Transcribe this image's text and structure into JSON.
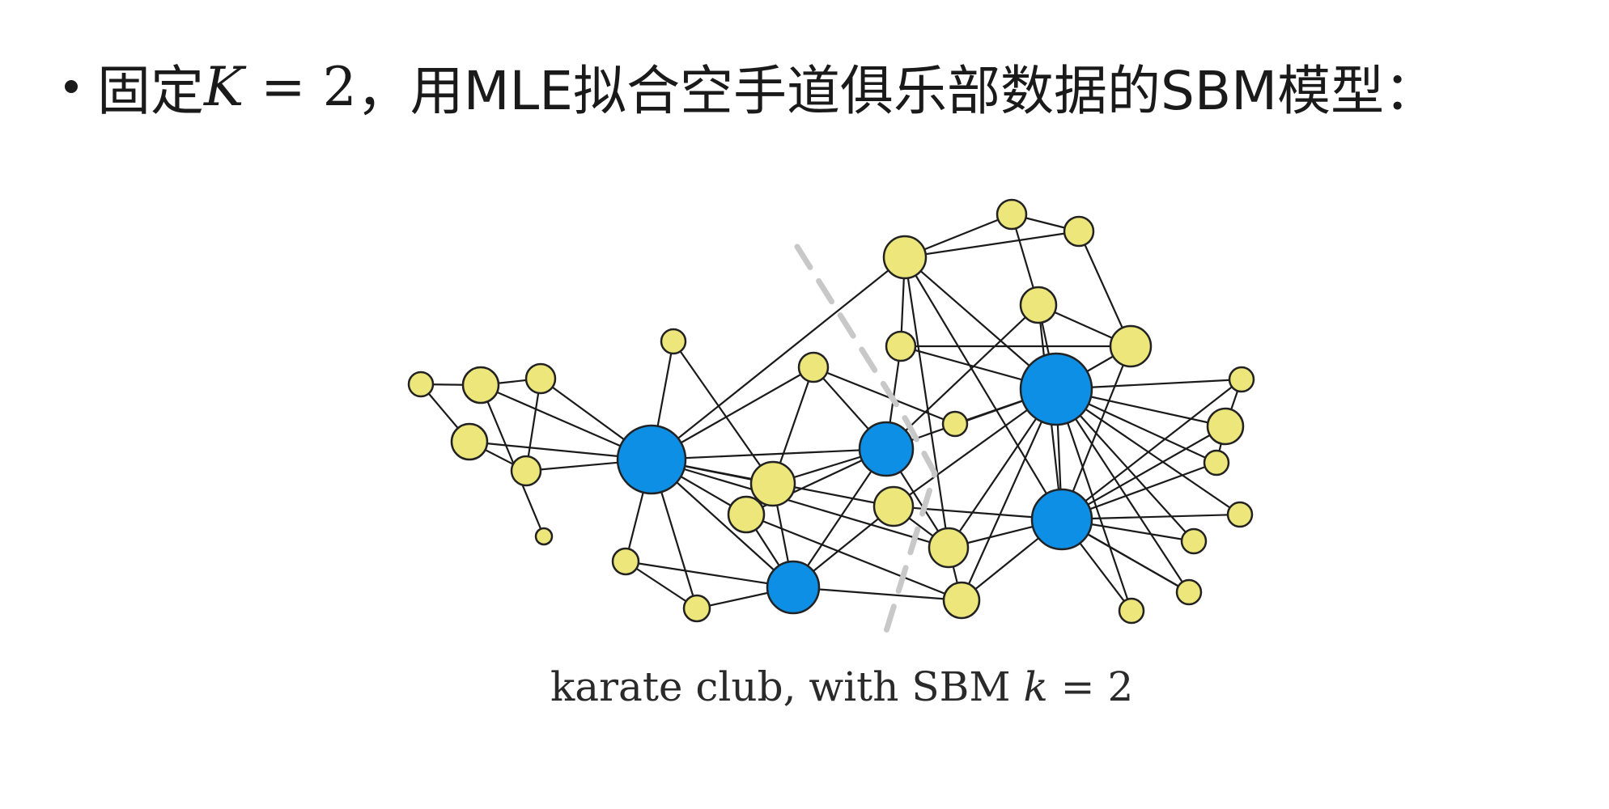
{
  "heading": {
    "prefix": "固定",
    "variable": "K",
    "equation": " = 2",
    "suffix": "，用MLE拟合空手道俱乐部数据的SBM模型："
  },
  "caption": {
    "text": "karate club, with SBM ",
    "variable": "k",
    "equation": " = 2"
  },
  "colors": {
    "hub": "#0d8fe6",
    "node": "#ede67a",
    "edge": "#1a1a1a",
    "separator": "#c8c8c8"
  },
  "graph": {
    "node_kinds": [
      "hub",
      "member"
    ],
    "separator": "dashed"
  }
}
